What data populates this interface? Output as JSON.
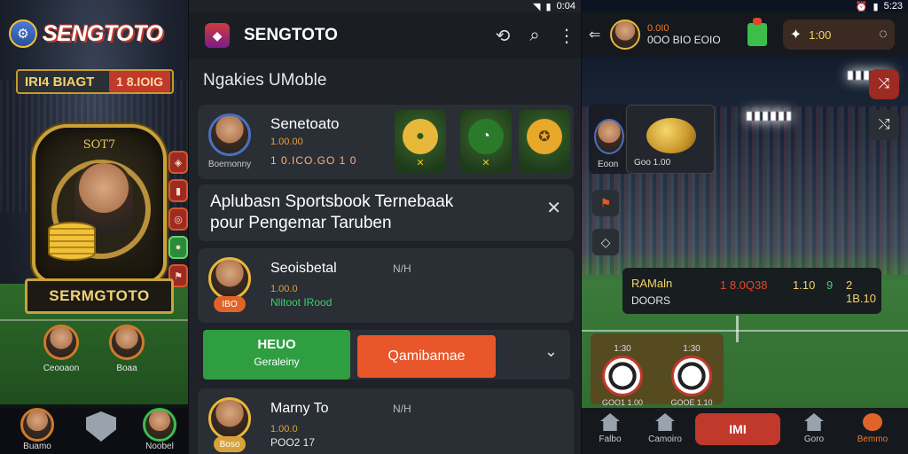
{
  "left": {
    "logo": "SENGTOTO",
    "score_left": "IRI4 BIAGT",
    "score_right": "1 8.IOIG",
    "shield_caption": "SOT7",
    "nameplate": "SERMGTOTO",
    "players": [
      {
        "caption": "Ceooaon"
      },
      {
        "caption": "Boaa"
      }
    ],
    "bottom": [
      {
        "label": "Buamo"
      },
      {
        "label": ""
      },
      {
        "label": "Noobel"
      }
    ]
  },
  "mid": {
    "status": "0:04",
    "title": "SENGTOTO",
    "subtitle": "Ngakies UMoble",
    "top_card": {
      "name": "Senetoato",
      "line1": "1.00.00",
      "odds": "1 0.ICO.GO  1  0",
      "avatar_caption": "Boernonny"
    },
    "promo": {
      "line1": "Aplubasn Sportsbook Ternebaak",
      "line2": "pour Pengemar Taruben"
    },
    "rows": [
      {
        "name": "Seoisbetal",
        "tag": "N/H",
        "line1": "1.00.0",
        "line2": "Nlitoot IRood",
        "pill": "IBO"
      },
      {
        "name": "Marny To",
        "tag": "N/H",
        "line1": "1.00.0",
        "line2": "POO2  17",
        "pill": "Boso"
      }
    ],
    "buttons": {
      "green_top": "HEUO",
      "green_bottom": "Geraleiny",
      "orange": "Qamibamae"
    }
  },
  "right": {
    "status": "5:23",
    "header_line1": "0.0I0",
    "header_line2": "0OO BIO EOIO",
    "wallet_amount": "1:00",
    "card_caption": "Eoon",
    "coin_caption": "Goo 1.00",
    "scoreboard": {
      "team1": "RAMaln",
      "team2": "DOORS",
      "odds1": "1 8.0Q38",
      "odds2": "1.10",
      "odds3": "9",
      "odds4": "2 1B.10"
    },
    "balls": [
      {
        "num": "1:30",
        "cap": "GOO1 1.00"
      },
      {
        "num": "1:30",
        "cap": "GOOE 1.10"
      }
    ],
    "bottom": [
      {
        "label": "Falbo"
      },
      {
        "label": "Camoiro"
      },
      {
        "label": "IMI"
      },
      {
        "label": "Goro"
      },
      {
        "label": "Bemmo"
      }
    ]
  }
}
